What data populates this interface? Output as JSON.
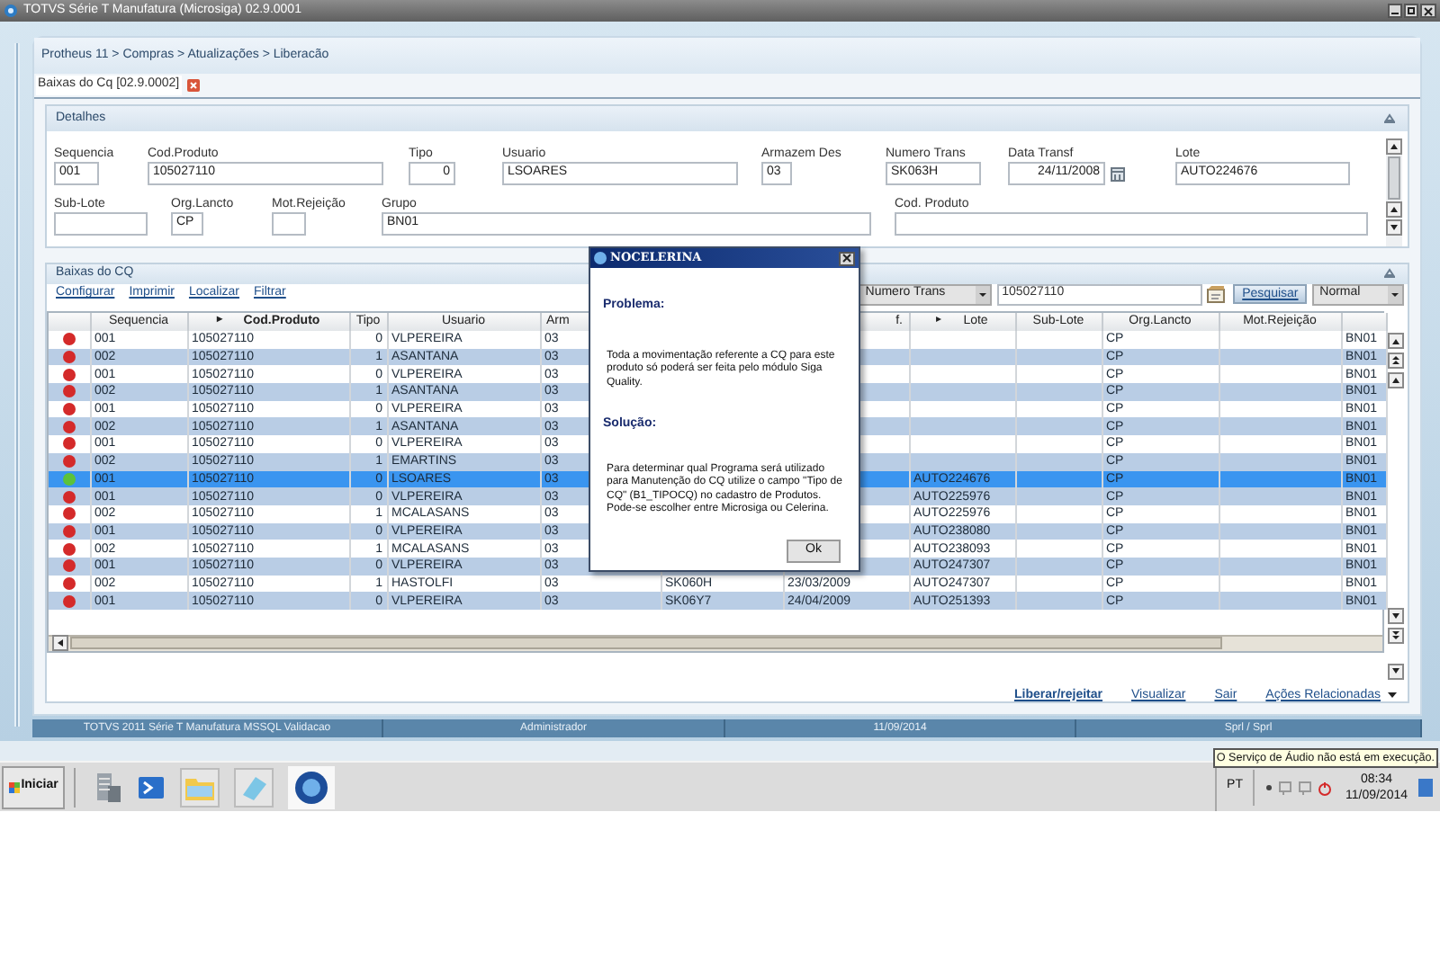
{
  "window": {
    "title": "TOTVS Série T Manufatura (Microsiga) 02.9.0001"
  },
  "breadcrumb": "Protheus 11 > Compras > Atualizações > Liberacão",
  "tab": {
    "label": "Baixas do Cq [02.9.0002]"
  },
  "details": {
    "title": "Detalhes",
    "fields": [
      {
        "label": "Sequencia",
        "value": "001"
      },
      {
        "label": "Cod.Produto",
        "value": "105027110"
      },
      {
        "label": "Tipo",
        "value": "0"
      },
      {
        "label": "Usuario",
        "value": "LSOARES"
      },
      {
        "label": "Armazem Des",
        "value": "03"
      },
      {
        "label": "Numero Trans",
        "value": "SK063H"
      },
      {
        "label": "Data Transf",
        "value": "24/11/2008",
        "kind": "date"
      },
      {
        "label": "Lote",
        "value": "AUTO224676"
      },
      {
        "label": "Sub-Lote"
      },
      {
        "label": "Org.Lancto",
        "value": "CP"
      },
      {
        "label": "Mot.Rejeição"
      },
      {
        "label": "Grupo",
        "value": "BN01"
      },
      {
        "label": "Cod. Produto"
      }
    ]
  },
  "grid_panel": {
    "title": "Baixas do CQ",
    "links": [
      "Configurar",
      "Imprimir",
      "Localizar",
      "Filtrar"
    ],
    "search_by": "Numero Trans",
    "search_value": "105027110",
    "search_button": "Pesquisar",
    "view": "Normal",
    "columns": [
      {},
      {
        "label": "Sequencia"
      },
      {
        "label": "Cod.Produto",
        "marker": "▸",
        "active": true
      },
      {
        "label": "Tipo"
      },
      {
        "label": "Usuario"
      },
      {
        "label": "Arm"
      },
      {},
      {
        "label": "f."
      },
      {
        "label": "Lote",
        "marker": "▸"
      },
      {
        "label": "Sub-Lote"
      },
      {
        "label": "Org.Lancto"
      },
      {
        "label": "Mot.Rejeição"
      },
      {}
    ],
    "rows": [
      {
        "color": "#d42a2a",
        "selected": false,
        "sequencia": "001",
        "cod_produto": "105027110",
        "tipo": "0",
        "usuario": "VLPEREIRA",
        "armazem": "03",
        "org_lancto": "CP",
        "grupo": "BN01"
      },
      {
        "color": "#d42a2a",
        "selected": false,
        "sequencia": "002",
        "cod_produto": "105027110",
        "tipo": "1",
        "usuario": "ASANTANA",
        "armazem": "03",
        "org_lancto": "CP",
        "grupo": "BN01"
      },
      {
        "color": "#d42a2a",
        "selected": false,
        "sequencia": "001",
        "cod_produto": "105027110",
        "tipo": "0",
        "usuario": "VLPEREIRA",
        "armazem": "03",
        "org_lancto": "CP",
        "grupo": "BN01"
      },
      {
        "color": "#d42a2a",
        "selected": false,
        "sequencia": "002",
        "cod_produto": "105027110",
        "tipo": "1",
        "usuario": "ASANTANA",
        "armazem": "03",
        "org_lancto": "CP",
        "grupo": "BN01"
      },
      {
        "color": "#d42a2a",
        "selected": false,
        "sequencia": "001",
        "cod_produto": "105027110",
        "tipo": "0",
        "usuario": "VLPEREIRA",
        "armazem": "03",
        "org_lancto": "CP",
        "grupo": "BN01"
      },
      {
        "color": "#d42a2a",
        "selected": false,
        "sequencia": "002",
        "cod_produto": "105027110",
        "tipo": "1",
        "usuario": "ASANTANA",
        "armazem": "03",
        "org_lancto": "CP",
        "grupo": "BN01"
      },
      {
        "color": "#d42a2a",
        "selected": false,
        "sequencia": "001",
        "cod_produto": "105027110",
        "tipo": "0",
        "usuario": "VLPEREIRA",
        "armazem": "03",
        "org_lancto": "CP",
        "grupo": "BN01"
      },
      {
        "color": "#d42a2a",
        "selected": false,
        "sequencia": "002",
        "cod_produto": "105027110",
        "tipo": "1",
        "usuario": "EMARTINS",
        "armazem": "03",
        "org_lancto": "CP",
        "grupo": "BN01"
      },
      {
        "color": "#5cc23a",
        "selected": true,
        "sequencia": "001",
        "cod_produto": "105027110",
        "tipo": "0",
        "usuario": "LSOARES",
        "armazem": "03",
        "lote": "AUTO224676",
        "org_lancto": "CP",
        "grupo": "BN01"
      },
      {
        "color": "#d42a2a",
        "selected": false,
        "sequencia": "001",
        "cod_produto": "105027110",
        "tipo": "0",
        "usuario": "VLPEREIRA",
        "armazem": "03",
        "lote": "AUTO225976",
        "org_lancto": "CP",
        "grupo": "BN01"
      },
      {
        "color": "#d42a2a",
        "selected": false,
        "sequencia": "002",
        "cod_produto": "105027110",
        "tipo": "1",
        "usuario": "MCALASANS",
        "armazem": "03",
        "lote": "AUTO225976",
        "org_lancto": "CP",
        "grupo": "BN01"
      },
      {
        "color": "#d42a2a",
        "selected": false,
        "sequencia": "001",
        "cod_produto": "105027110",
        "tipo": "0",
        "usuario": "VLPEREIRA",
        "armazem": "03",
        "lote": "AUTO238080",
        "org_lancto": "CP",
        "grupo": "BN01"
      },
      {
        "color": "#d42a2a",
        "selected": false,
        "sequencia": "002",
        "cod_produto": "105027110",
        "tipo": "1",
        "usuario": "MCALASANS",
        "armazem": "03",
        "lote": "AUTO238093",
        "org_lancto": "CP",
        "grupo": "BN01"
      },
      {
        "color": "#d42a2a",
        "selected": false,
        "sequencia": "001",
        "cod_produto": "105027110",
        "tipo": "0",
        "usuario": "VLPEREIRA",
        "armazem": "03",
        "lote": "AUTO247307",
        "org_lancto": "CP",
        "grupo": "BN01"
      },
      {
        "color": "#d42a2a",
        "selected": false,
        "sequencia": "002",
        "cod_produto": "105027110",
        "tipo": "1",
        "usuario": "HASTOLFI",
        "armazem": "03",
        "numero_trans": "SK060H",
        "data": "23/03/2009",
        "lote": "AUTO247307",
        "org_lancto": "CP",
        "grupo": "BN01"
      },
      {
        "color": "#d42a2a",
        "selected": false,
        "sequencia": "001",
        "cod_produto": "105027110",
        "tipo": "0",
        "usuario": "VLPEREIRA",
        "armazem": "03",
        "numero_trans": "SK06Y7",
        "data": "24/04/2009",
        "lote": "AUTO251393",
        "org_lancto": "CP",
        "grupo": "BN01"
      }
    ],
    "actions": [
      {
        "label": "Liberar/rejeitar",
        "kind": "primary"
      },
      {
        "label": "Visualizar",
        "kind": "link"
      },
      {
        "label": "Sair",
        "kind": "link"
      },
      {
        "label": "Ações Relacionadas",
        "kind": "menu"
      }
    ]
  },
  "status_bar": [
    "TOTVS 2011 Série T Manufatura MSSQL Validacao",
    "Administrador",
    "11/09/2014",
    "Sprl / Sprl"
  ],
  "dialog": {
    "title": "NOCELERINA",
    "sections": [
      {
        "heading": "Problema:",
        "text": "Toda a movimentação referente a CQ para este produto só poderá ser feita pelo  módulo Siga Quality."
      },
      {
        "heading": "Solução:",
        "text": "Para determinar qual Programa será utilizado para Manutenção do CQ utilize o campo \"Tipo de CQ\" (B1_TIPOCQ) no cadastro de Produtos. Pode-se escolher entre Microsiga ou Celerina."
      }
    ],
    "button": "Ok"
  },
  "taskbar": {
    "start": "Iniciar",
    "language": "PT",
    "time": "08:34",
    "date": "11/09/2014",
    "tooltip": "O Serviço de Áudio não está em execução."
  }
}
